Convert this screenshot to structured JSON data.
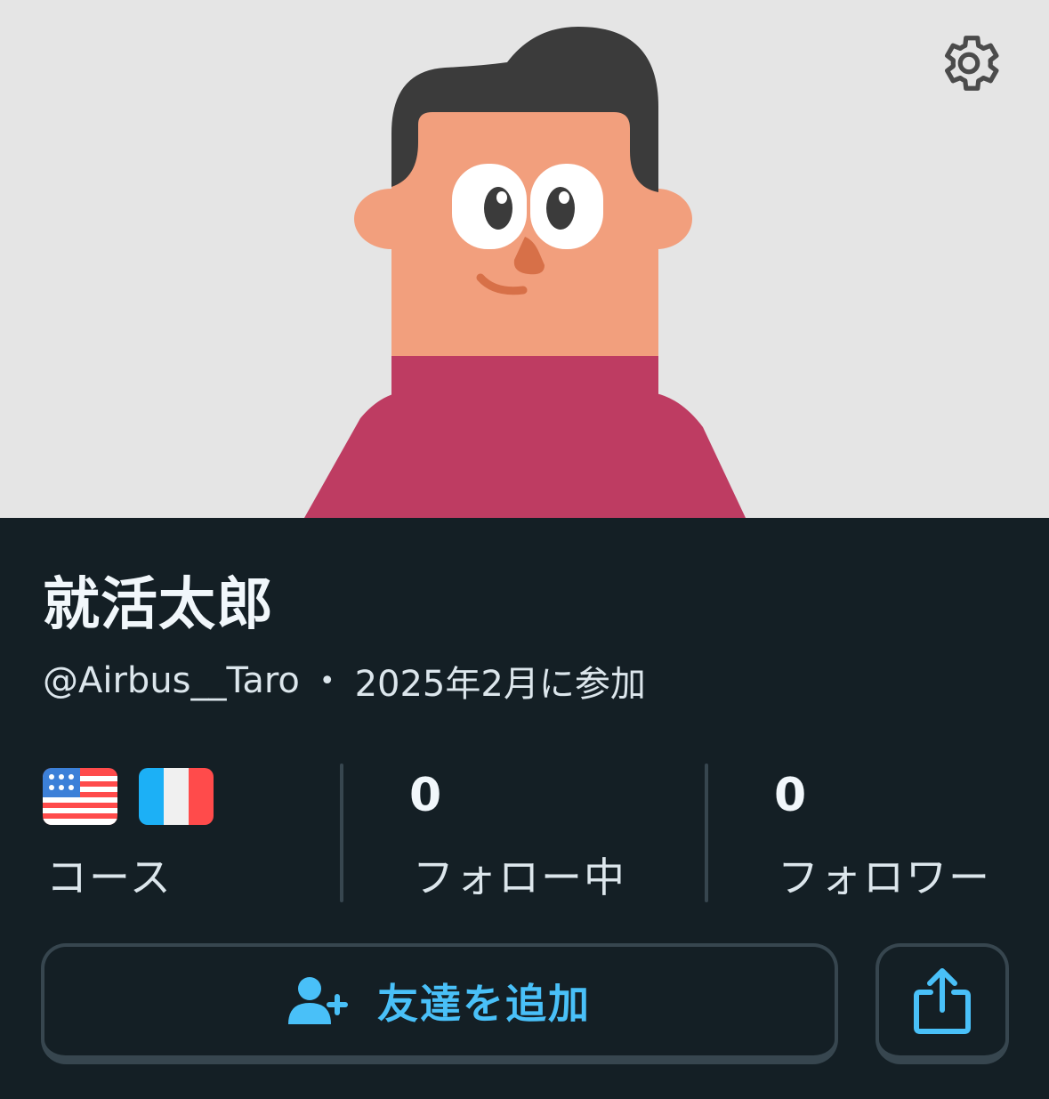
{
  "profile": {
    "name": "就活太郎",
    "username": "@Airbus__Taro",
    "separator": "•",
    "joined": "2025年2月に参加"
  },
  "stats": {
    "courses_label": "コース",
    "courses": [
      {
        "flag": "us-flag-icon"
      },
      {
        "flag": "france-flag-icon"
      }
    ],
    "following_count": "0",
    "following_label": "フォロー中",
    "followers_count": "0",
    "followers_label": "フォロワー"
  },
  "actions": {
    "add_friend_label": "友達を追加",
    "add_friend_icon": "add-user-icon",
    "share_icon": "share-icon",
    "settings_icon": "gear-icon"
  },
  "colors": {
    "background": "#141f25",
    "avatar_background": "#e5e5e5",
    "accent": "#49c0f8",
    "border": "#37464f"
  }
}
